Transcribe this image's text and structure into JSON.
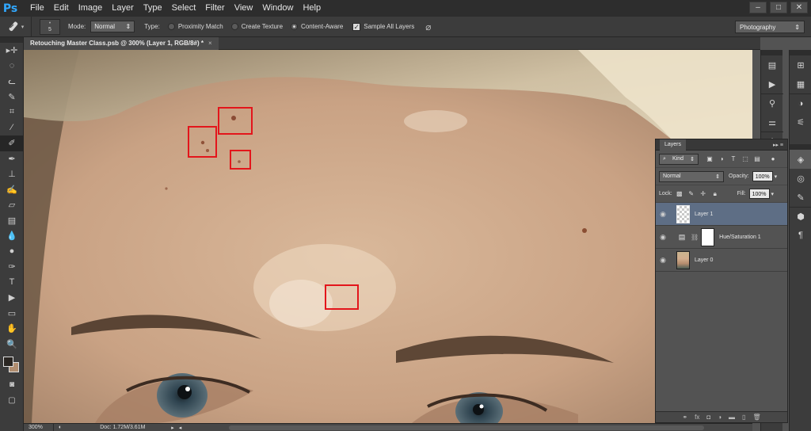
{
  "app": {
    "logo": "Ps"
  },
  "menu": [
    "File",
    "Edit",
    "Image",
    "Layer",
    "Type",
    "Select",
    "Filter",
    "View",
    "Window",
    "Help"
  ],
  "window_controls": {
    "minimize": "–",
    "restore": "□",
    "close": "✕"
  },
  "options": {
    "tool_icon": "spot-healing-brush-icon",
    "brush_size": "5",
    "mode_label": "Mode:",
    "mode_value": "Normal",
    "type_label": "Type:",
    "type_options": [
      "Proximity Match",
      "Create Texture",
      "Content-Aware"
    ],
    "type_selected": "Content-Aware",
    "sample_all_layers": "Sample All Layers",
    "sample_all_checked": true,
    "workspace": "Photography"
  },
  "document": {
    "tab_title": "Retouching Master Class.psb @ 300% (Layer 1, RGB/8#) *",
    "tab_close": "×"
  },
  "tools": [
    "move-tool-icon",
    "marquee-tool-icon",
    "lasso-tool-icon",
    "quick-selection-tool-icon",
    "crop-tool-icon",
    "eyedropper-tool-icon",
    "spot-healing-brush-tool-icon",
    "brush-tool-icon",
    "clone-stamp-tool-icon",
    "history-brush-tool-icon",
    "eraser-tool-icon",
    "gradient-tool-icon",
    "blur-tool-icon",
    "dodge-tool-icon",
    "pen-tool-icon",
    "type-tool-icon",
    "path-selection-tool-icon",
    "rectangle-tool-icon",
    "hand-tool-icon",
    "zoom-tool-icon"
  ],
  "tool_glyphs": [
    "▸✛",
    "◌",
    "ᓚ",
    "✎",
    "⌗",
    "⁄",
    "✐",
    "✒",
    "⊥",
    "✍",
    "▱",
    "▤",
    "💧",
    "●",
    "✑",
    "T",
    "▶",
    "▭",
    "✋",
    "🔍"
  ],
  "status": {
    "zoom": "300%",
    "doc": "Doc: 1.72M/3.61M"
  },
  "layers_panel": {
    "title": "Layers",
    "filter_kind": "Kind",
    "blend_mode": "Normal",
    "opacity_label": "Opacity:",
    "opacity_value": "100%",
    "lock_label": "Lock:",
    "fill_label": "Fill:",
    "fill_value": "100%",
    "layers": [
      {
        "name": "Layer 1",
        "active": true
      },
      {
        "name": "Hue/Saturation 1",
        "active": false
      },
      {
        "name": "Layer 0",
        "active": false
      }
    ],
    "footer_icons": [
      "link-icon",
      "fx",
      "mask-icon",
      "adjustment-icon",
      "folder-icon",
      "new-layer-icon",
      "trash-icon"
    ]
  },
  "colors": {
    "highlight_box": "#e3151b",
    "ps_blue": "#31a8ff",
    "active_layer": "#5e6e85"
  }
}
